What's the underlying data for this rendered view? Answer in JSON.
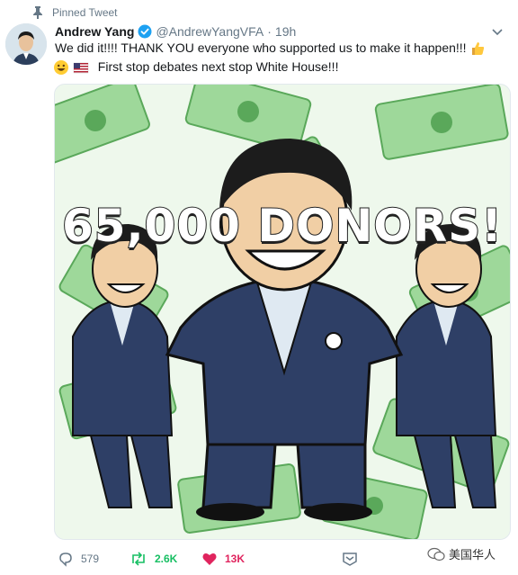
{
  "pinned": {
    "label": "Pinned Tweet",
    "icon": "pin-icon"
  },
  "author": {
    "name": "Andrew Yang",
    "handle": "@AndrewYangVFA",
    "separator": "·",
    "time": "19h",
    "verified_icon": "verified-badge-icon",
    "avatar_alt": "avatar"
  },
  "tweet": {
    "line1": "We did it!!!!  THANK YOU everyone who supported us to make it happen!!! ",
    "line2": "First stop debates next stop White House!!!",
    "emojis": [
      "thumbs-up-icon",
      "smiley-icon",
      "us-flag-icon"
    ]
  },
  "media": {
    "headline": "65,000 DONORS!"
  },
  "actions": {
    "reply_count": "579",
    "retweet_count": "2.6K",
    "like_count": "13K"
  },
  "watermark": {
    "text": "美国华人"
  },
  "colors": {
    "retweet_green": "#17bf63",
    "like_red": "#e0245e",
    "verified_blue": "#1da1f2",
    "money_green": "#8fd08a"
  }
}
